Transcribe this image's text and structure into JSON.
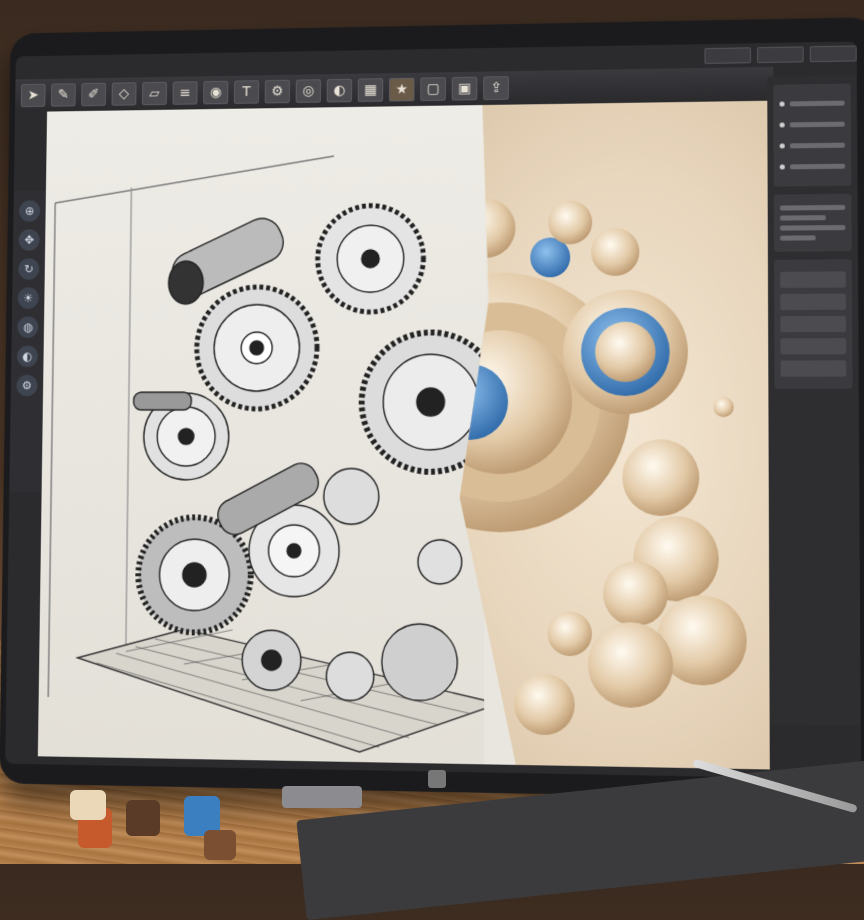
{
  "toolbar": {
    "tools": [
      {
        "name": "select-tool",
        "icon": "pointer-icon",
        "glyph": "➤"
      },
      {
        "name": "pen-tool",
        "icon": "pen-icon",
        "glyph": "✎"
      },
      {
        "name": "brush-tool",
        "icon": "brush-icon",
        "glyph": "✐"
      },
      {
        "name": "shape-tool",
        "icon": "shape-icon",
        "glyph": "◇"
      },
      {
        "name": "eraser-tool",
        "icon": "eraser-icon",
        "glyph": "▱"
      },
      {
        "name": "layers-tool",
        "icon": "layers-icon",
        "glyph": "≡"
      },
      {
        "name": "fill-tool",
        "icon": "fill-icon",
        "glyph": "◉"
      },
      {
        "name": "text-tool",
        "icon": "text-icon",
        "glyph": "T"
      },
      {
        "name": "gear-tool",
        "icon": "gear-icon",
        "glyph": "⚙"
      },
      {
        "name": "camera-tool",
        "icon": "camera-icon",
        "glyph": "◎"
      },
      {
        "name": "render-tool",
        "icon": "render-icon",
        "glyph": "◐"
      },
      {
        "name": "grid-tool",
        "icon": "grid-icon",
        "glyph": "▦"
      },
      {
        "name": "star-tool",
        "icon": "star-icon",
        "glyph": "★"
      },
      {
        "name": "frame-tool",
        "icon": "frame-icon",
        "glyph": "▢"
      },
      {
        "name": "image-tool",
        "icon": "image-icon",
        "glyph": "▣"
      },
      {
        "name": "export-tool",
        "icon": "export-icon",
        "glyph": "⇪"
      }
    ]
  },
  "left_tools": [
    {
      "icon": "zoom-icon",
      "glyph": "⊕"
    },
    {
      "icon": "move-icon",
      "glyph": "✥"
    },
    {
      "icon": "rotate-icon",
      "glyph": "↻"
    },
    {
      "icon": "light-icon",
      "glyph": "☀"
    },
    {
      "icon": "material-icon",
      "glyph": "◍"
    },
    {
      "icon": "view-icon",
      "glyph": "◐"
    },
    {
      "icon": "settings-icon",
      "glyph": "⚙"
    }
  ],
  "colors": {
    "accent_blue": "#3b7fc0",
    "render_cream": "#e8d6bd",
    "sketch_paper": "#e9e6df"
  }
}
